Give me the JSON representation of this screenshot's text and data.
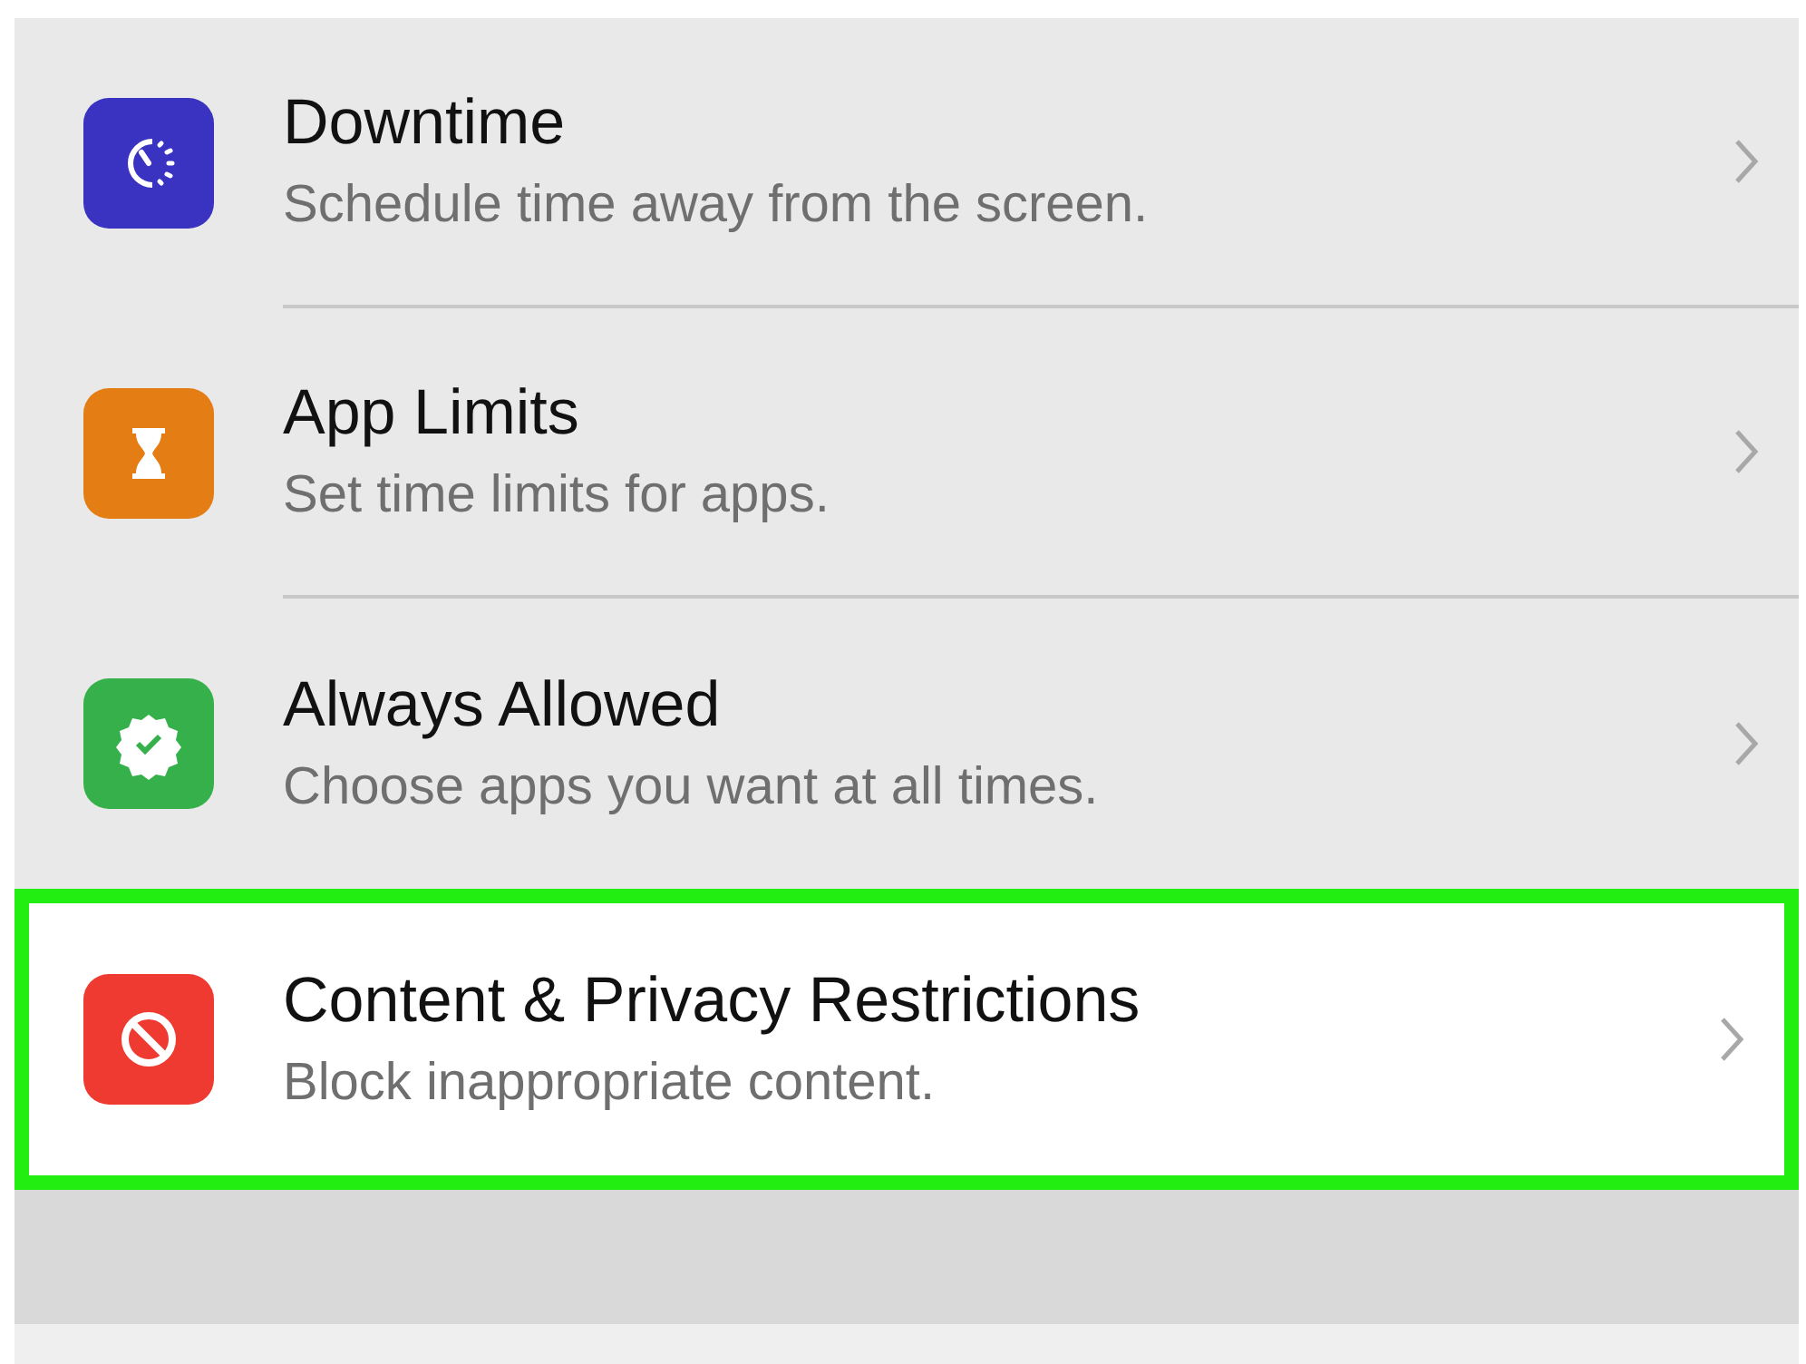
{
  "rows": [
    {
      "title": "Downtime",
      "subtitle": "Schedule time away from the screen.",
      "color": "#3a33c2",
      "highlighted": false
    },
    {
      "title": "App Limits",
      "subtitle": "Set time limits for apps.",
      "color": "#e47d14",
      "highlighted": false
    },
    {
      "title": "Always Allowed",
      "subtitle": "Choose apps you want at all times.",
      "color": "#35b04b",
      "highlighted": false
    },
    {
      "title": "Content & Privacy Restrictions",
      "subtitle": "Block inappropriate content.",
      "color": "#ee3a30",
      "highlighted": true
    }
  ]
}
